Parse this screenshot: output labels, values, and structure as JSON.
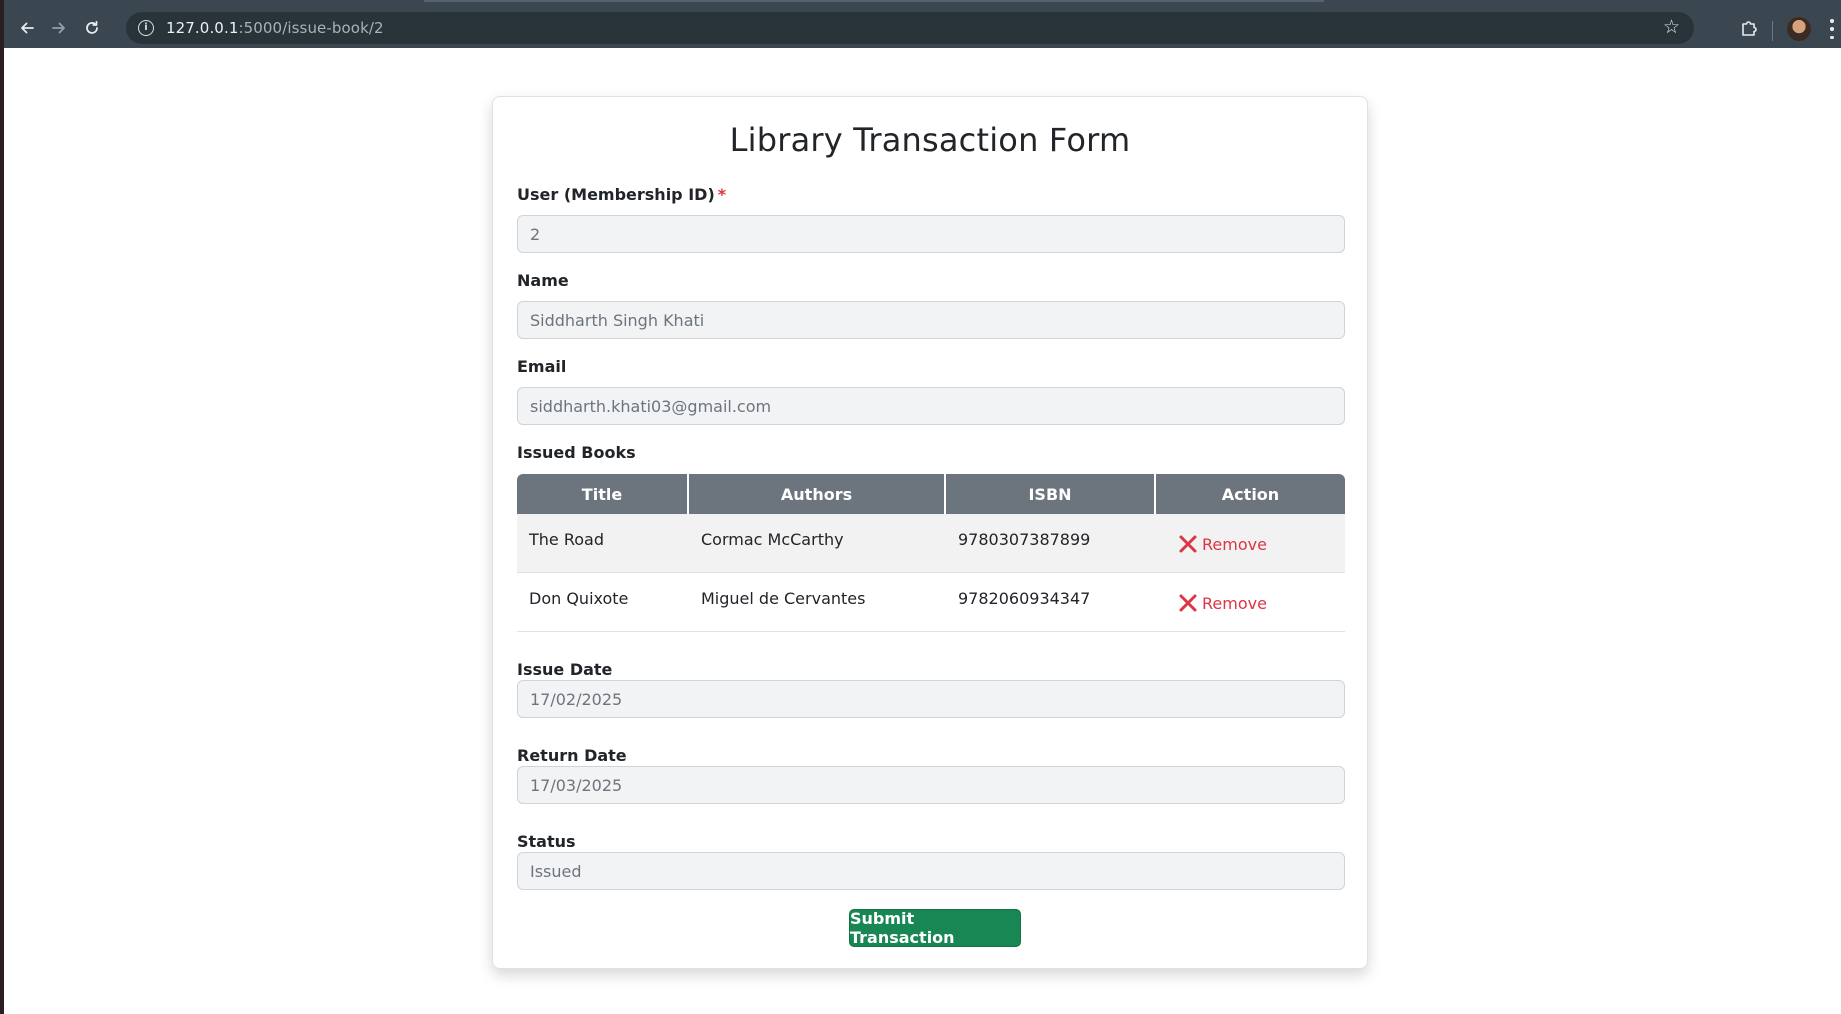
{
  "browser": {
    "url_host": "127.0.0.1",
    "url_path": ":5000/issue-book/2"
  },
  "form": {
    "title": "Library Transaction Form",
    "user_label": "User (Membership ID)",
    "required_mark": "*",
    "user_value": "2",
    "name_label": "Name",
    "name_value": "Siddharth Singh Khati",
    "email_label": "Email",
    "email_value": "siddharth.khati03@gmail.com",
    "issued_books_label": "Issued Books",
    "table": {
      "headers": [
        "Title",
        "Authors",
        "ISBN",
        "Action"
      ],
      "rows": [
        {
          "title": "The Road",
          "authors": "Cormac McCarthy",
          "isbn": "9780307387899",
          "action": "Remove"
        },
        {
          "title": "Don Quixote",
          "authors": "Miguel de Cervantes",
          "isbn": "9782060934347",
          "action": "Remove"
        }
      ]
    },
    "issue_date_label": "Issue Date",
    "issue_date_value": "17/02/2025",
    "return_date_label": "Return Date",
    "return_date_value": "17/03/2025",
    "status_label": "Status",
    "status_value": "Issued",
    "submit_label": "Submit Transaction"
  },
  "colors": {
    "header_bg": "#6c757d",
    "remove": "#dc3545",
    "submit": "#198754",
    "chrome": "#3a4750"
  },
  "icons": {
    "back": "back-arrow-icon",
    "forward": "forward-arrow-icon",
    "reload": "reload-icon",
    "site_info": "info-icon",
    "bookmark": "star-icon",
    "extensions": "puzzle-icon",
    "menu": "kebab-menu-icon",
    "remove": "close-x-icon"
  }
}
